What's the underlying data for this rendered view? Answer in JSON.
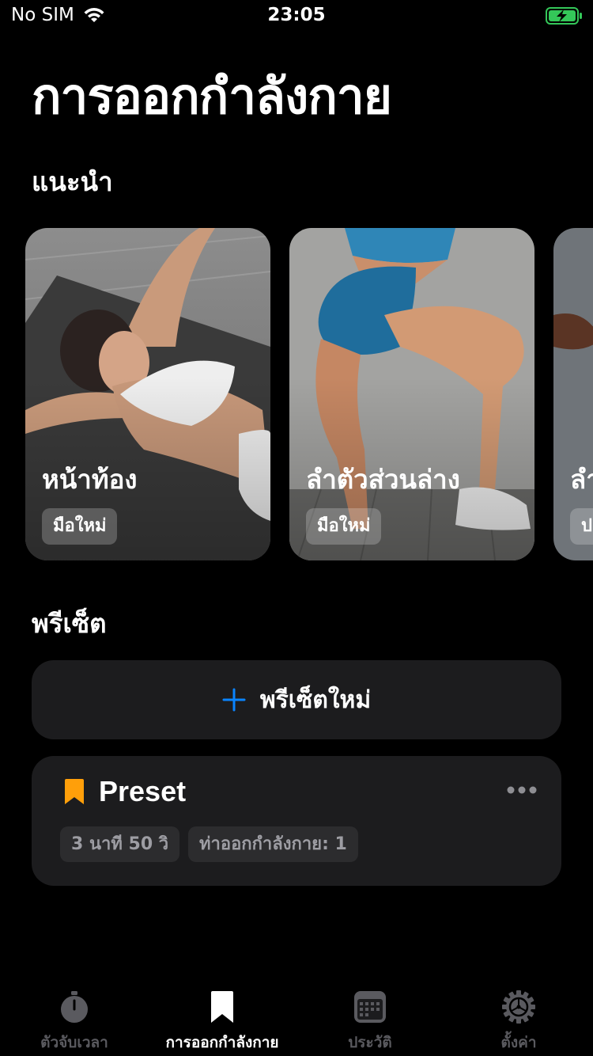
{
  "status_bar": {
    "carrier": "No SIM",
    "time": "23:05",
    "battery_color": "#34c759"
  },
  "page_title": "การออกกำลังกาย",
  "featured": {
    "section_title": "แนะนำ",
    "cards": [
      {
        "title": "หน้าท้อง",
        "level": "มือใหม่"
      },
      {
        "title": "ลำตัวส่วนล่าง",
        "level": "มือใหม่"
      },
      {
        "title": "ลำ",
        "level": "ป"
      }
    ]
  },
  "presets": {
    "section_title": "พรีเซ็ต",
    "new_preset_label": "พรีเซ็ตใหม่",
    "accent_color": "#0a84ff",
    "items": [
      {
        "name": "Preset",
        "duration": "3 นาที 50 วิ",
        "exercises": "ท่าออกกำลังกาย: 1",
        "bookmark_color": "#ff9f0a"
      }
    ]
  },
  "tab_bar": {
    "tabs": [
      {
        "label": "ตัวจับเวลา",
        "icon": "stopwatch-icon",
        "active": false
      },
      {
        "label": "การออกกำลังกาย",
        "icon": "bookmark-icon",
        "active": true
      },
      {
        "label": "ประวัติ",
        "icon": "calendar-icon",
        "active": false
      },
      {
        "label": "ตั้งค่า",
        "icon": "gear-icon",
        "active": false
      }
    ]
  }
}
